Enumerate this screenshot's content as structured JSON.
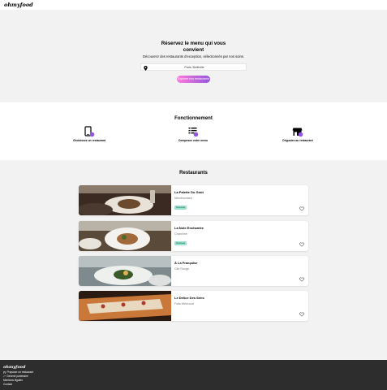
{
  "header": {
    "logo": "ohmyfood"
  },
  "hero": {
    "title": "Réservez le menu qui vous convient",
    "subtitle": "Découvrez des restaurants d'exception, sélectionnés par nos soins.",
    "search_value": "Paris, Belleville",
    "search_button": "Explorer nos restaurants",
    "icon": "map-pin-icon"
  },
  "how": {
    "title": "Fonctionnement",
    "steps": [
      {
        "label": "Choisissez un restaurant",
        "icon": "phone-icon"
      },
      {
        "label": "Composez votre menu",
        "icon": "list-icon"
      },
      {
        "label": "Dégustez au restaurant",
        "icon": "store-icon"
      }
    ]
  },
  "restaurants": {
    "title": "Restaurants",
    "items": [
      {
        "name": "La Palette Du Goût",
        "location": "Ménilmontant",
        "badge": "Nouveau"
      },
      {
        "name": "La Note Enchantée",
        "location": "Charonne",
        "badge": "Nouveau"
      },
      {
        "name": "À La Française",
        "location": "Cité Rouge",
        "badge": ""
      },
      {
        "name": "Le Délice Des Sens",
        "location": "Folie-Méricourt",
        "badge": ""
      }
    ]
  },
  "footer": {
    "logo": "ohmyfood",
    "links": [
      "Proposer un restaurant",
      "Devenir partenaire",
      "Mentions légales",
      "Contact"
    ]
  },
  "colors": {
    "accent_start": "#ff79da",
    "accent_end": "#9356dc",
    "badge": "#99e2d0",
    "footer": "#2d2d2d"
  }
}
